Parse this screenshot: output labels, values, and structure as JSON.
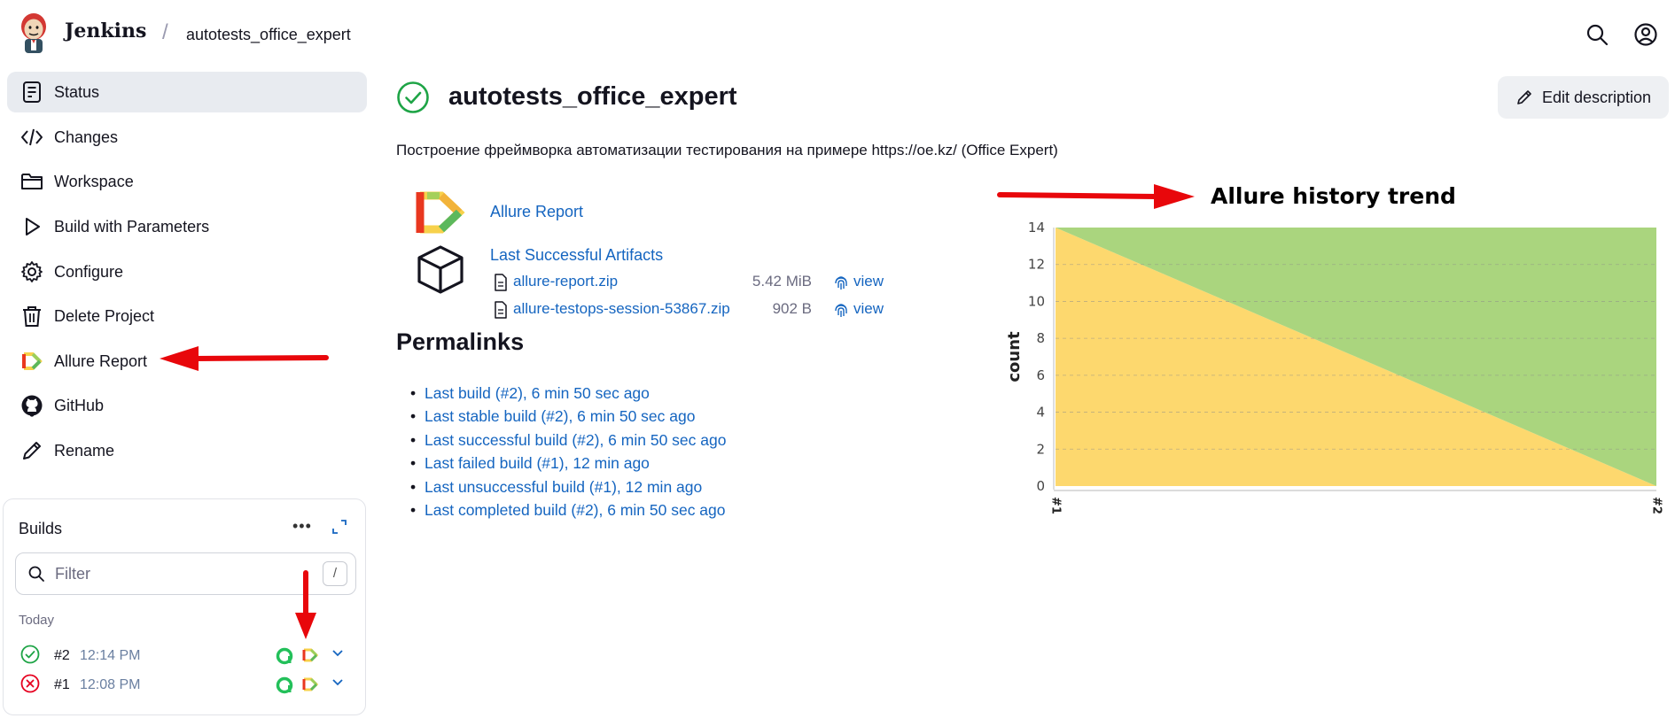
{
  "header": {
    "brand": "Jenkins",
    "separator": "/",
    "breadcrumb": "autotests_office_expert",
    "icons": [
      "search-icon",
      "user-icon"
    ]
  },
  "sidebar": {
    "items": [
      {
        "label": "Status",
        "icon": "status-icon",
        "active": true
      },
      {
        "label": "Changes",
        "icon": "code-icon"
      },
      {
        "label": "Workspace",
        "icon": "folder-icon"
      },
      {
        "label": "Build with Parameters",
        "icon": "play-icon"
      },
      {
        "label": "Configure",
        "icon": "gear-icon"
      },
      {
        "label": "Delete Project",
        "icon": "trash-icon"
      },
      {
        "label": "Allure Report",
        "icon": "allure-icon"
      },
      {
        "label": "GitHub",
        "icon": "github-icon"
      },
      {
        "label": "Rename",
        "icon": "pencil-icon"
      }
    ]
  },
  "builds": {
    "title": "Builds",
    "more": "•••",
    "filter_placeholder": "Filter",
    "filter_shortcut": "/",
    "group_label": "Today",
    "rows": [
      {
        "number": "#2",
        "time": "12:14 PM",
        "status": "success"
      },
      {
        "number": "#1",
        "time": "12:08 PM",
        "status": "failed"
      }
    ]
  },
  "main": {
    "title": "autotests_office_expert",
    "edit_button": "Edit description",
    "description": "Построение фреймворка автоматизации тестирования на примере https://oe.kz/ (Office Expert)",
    "allure_link": "Allure Report",
    "artifacts_link": "Last Successful Artifacts",
    "files": [
      {
        "name": "allure-report.zip",
        "size": "5.42 MiB",
        "view": "view"
      },
      {
        "name": "allure-testops-session-53867.zip",
        "size": "902 B",
        "view": "view"
      }
    ],
    "permalinks_title": "Permalinks",
    "permalinks": [
      "Last build (#2), 6 min 50 sec ago",
      "Last stable build (#2), 6 min 50 sec ago",
      "Last successful build (#2), 6 min 50 sec ago",
      "Last failed build (#1), 12 min ago",
      "Last unsuccessful build (#1), 12 min ago",
      "Last completed build (#2), 6 min 50 sec ago"
    ]
  },
  "colors": {
    "link": "#1565c0",
    "success": "#1ea446",
    "failed": "#e6001f",
    "passed_area": "#aad57e",
    "failed_area": "#fdd86e",
    "arrow": "#e8070b"
  },
  "chart_data": {
    "type": "area",
    "title": "Allure history trend",
    "xlabel": "",
    "ylabel": "count",
    "x": [
      "#1",
      "#2"
    ],
    "ylim": [
      0,
      14
    ],
    "yticks": [
      0,
      2,
      4,
      6,
      8,
      10,
      12,
      14
    ],
    "grid": true,
    "series": [
      {
        "values": [
          14,
          0
        ],
        "color": "#fdd86e"
      },
      {
        "values": [
          0,
          14
        ],
        "color": "#aad57e"
      }
    ]
  }
}
